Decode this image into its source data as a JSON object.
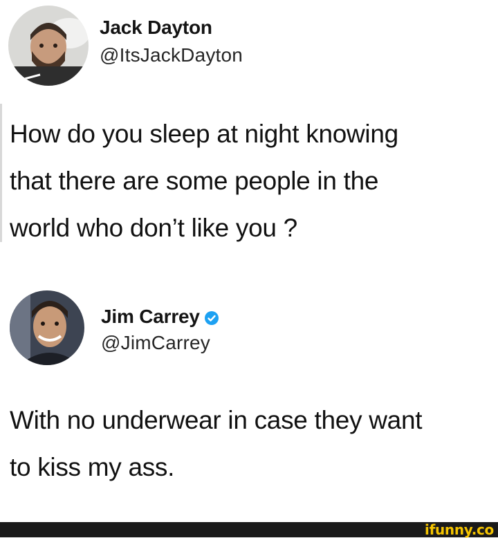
{
  "tweets": [
    {
      "name": "Jack Dayton",
      "handle": "@ItsJackDayton",
      "verified": false,
      "avatar_icon": "person-avatar-icon",
      "text_lines": [
        "How do you sleep at night knowing",
        "that there are some people in the",
        "world who don’t like you ?"
      ]
    },
    {
      "name": "Jim Carrey",
      "handle": "@JimCarrey",
      "verified": true,
      "avatar_icon": "person-avatar-icon",
      "text_lines": [
        "With no underwear in case they want",
        "to kiss my ass."
      ]
    }
  ],
  "colors": {
    "verified_badge": "#1da1f2",
    "watermark": "#f5c400",
    "footer": "#1a1a1a"
  },
  "footer": {
    "watermark": "ifunny.co"
  }
}
